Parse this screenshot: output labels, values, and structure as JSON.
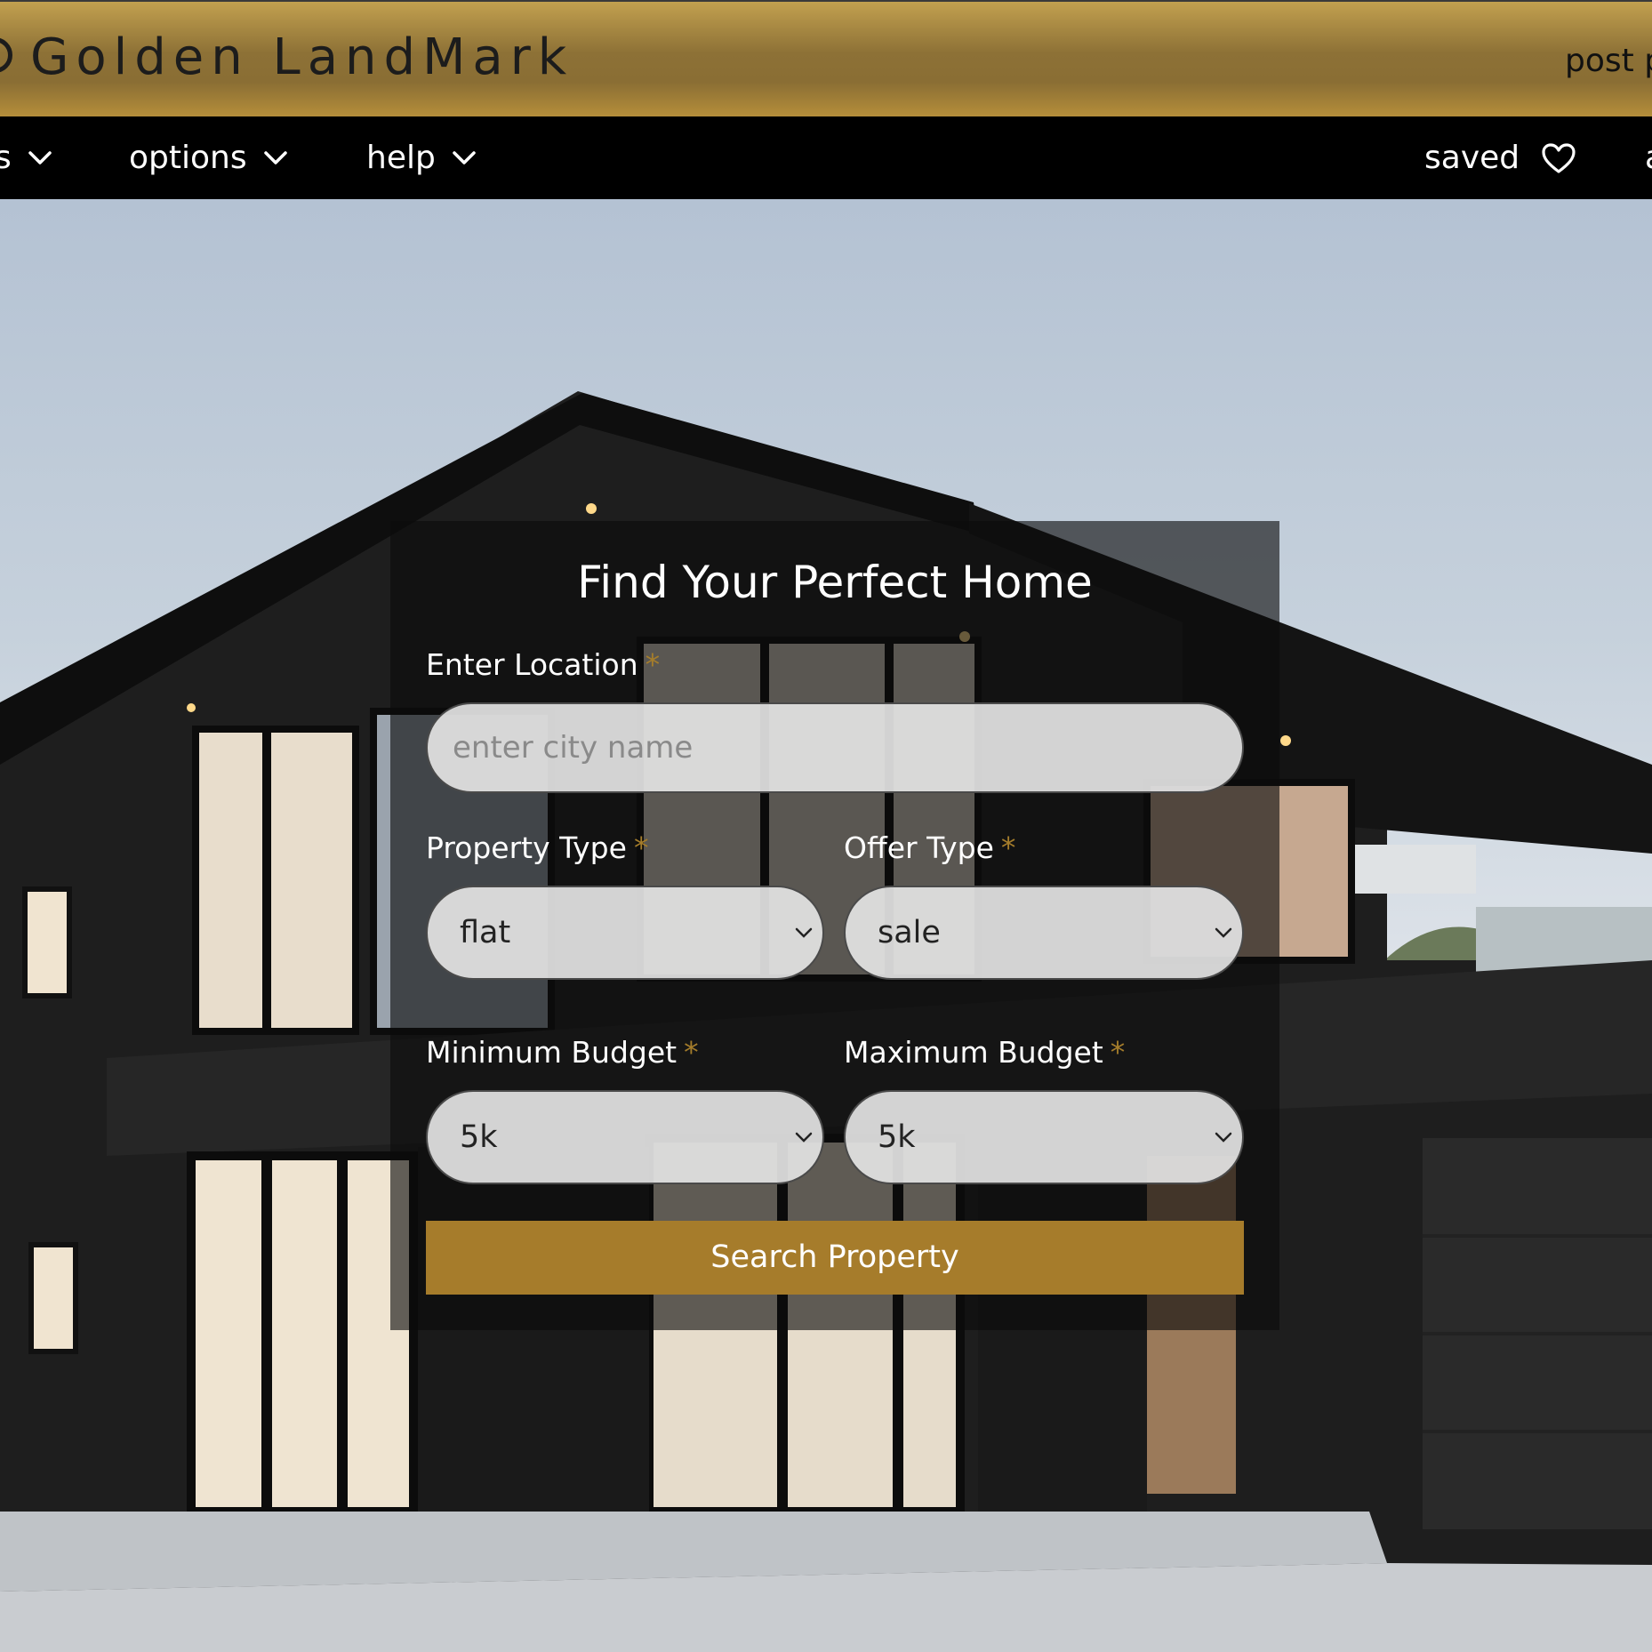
{
  "header": {
    "brand_name": "Golden LandMark",
    "post_link": "post p",
    "colors": {
      "gold_top": "#c2a04f",
      "gold_mid": "#8a6e34",
      "nav_bg": "#000000"
    }
  },
  "nav": {
    "items": [
      {
        "label": "s",
        "icon": "chevron-down-icon"
      },
      {
        "label": "options",
        "icon": "chevron-down-icon"
      },
      {
        "label": "help",
        "icon": "chevron-down-icon"
      }
    ],
    "saved_label": "saved",
    "saved_icon": "heart-icon",
    "trailing_label": "a"
  },
  "search": {
    "title": "Find Your Perfect Home",
    "required_marker": "*",
    "location": {
      "label": "Enter Location",
      "placeholder": "enter city name",
      "value": ""
    },
    "property_type": {
      "label": "Property Type",
      "selected": "flat"
    },
    "offer_type": {
      "label": "Offer Type",
      "selected": "sale"
    },
    "min_budget": {
      "label": "Minimum Budget",
      "selected": "5k"
    },
    "max_budget": {
      "label": "Maximum Budget",
      "selected": "5k"
    },
    "submit_label": "Search Property",
    "accent_color": "#a67c2b"
  }
}
